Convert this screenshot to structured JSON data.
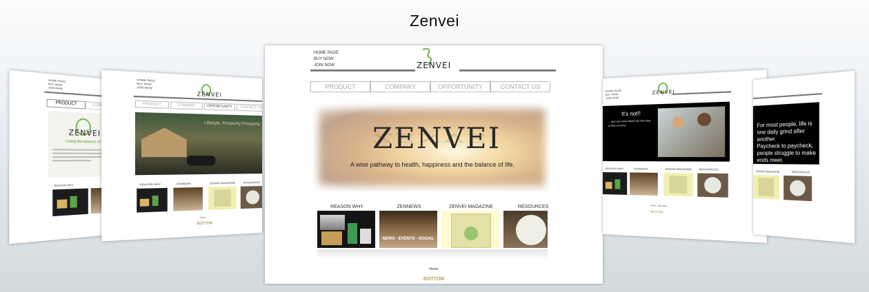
{
  "page_title": "Zenvei",
  "site": {
    "logo_text": "ZENVEI",
    "nav_links": [
      "HOME PAGE",
      "BUY NOW",
      "JOIN NOW"
    ],
    "menu": [
      "PRODUCT",
      "COMPANY",
      "OPPORTUNITY",
      "CONTACT US"
    ],
    "hero_title": "ZENVEI",
    "hero_tagline": "A wise pathway to health, happiness and the balance of life.",
    "sections": [
      "REASON WHY",
      "ZENNEWS",
      "ZENVEI MAGAZINE",
      "RESOURCES"
    ],
    "news_caption": "NEWS - EVENTS - SOCIAL",
    "footer_small": "Home",
    "footer_bottom": "BOTTOM"
  },
  "left_far": {
    "tab_active": "PRODUCT",
    "tab_next": "COMPANY",
    "logo": "ZENVEI",
    "tagline": "Living the balance of life"
  },
  "left_near": {
    "banner_text": "Lifestyle, Prosperity Prosperity"
  },
  "right_near": {
    "headline": "It's not!!",
    "body": "... and you have taken the first step to find out why.",
    "footer_home": "Home - Buy Now",
    "footer_bottom": "BOTTOM"
  },
  "right_far": {
    "body1": "For most people, life is one daily grind after another.",
    "body2": "Paycheck to paycheck, people struggle to make ends meet."
  },
  "colors": {
    "accent_gold": "#b5a25a",
    "logo_green": "#7db557"
  }
}
